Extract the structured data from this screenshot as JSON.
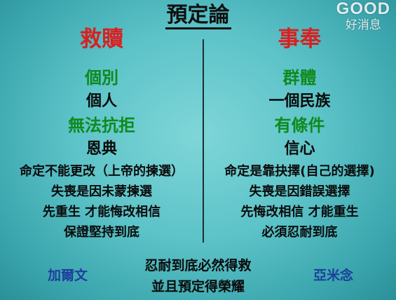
{
  "title": "預定論",
  "logo": {
    "en": "GOOD",
    "zh": "好消息"
  },
  "left": {
    "head": "救贖",
    "line1": "個別",
    "line2": "個人",
    "line3": "無法抗拒",
    "line4": "恩典",
    "line5": "命定不能更改（上帝的揀選）",
    "line6": "失喪是因未蒙揀選",
    "line7": "先重生 才能悔改相信",
    "line8": "保證堅持到底"
  },
  "right": {
    "head": "事奉",
    "line1": "群體",
    "line2": "一個民族",
    "line3": "有條件",
    "line4": "信心",
    "line5": "命定是靠抉擇(自己的選擇)",
    "line6": "失喪是因錯誤選擇",
    "line7": "先悔改相信 才能重生",
    "line8": "必須忍耐到底"
  },
  "bottom": {
    "line1": "忍耐到底必然得救",
    "line2": "並且預定得榮耀"
  },
  "books": {
    "left": "加爾文",
    "right": "亞米念"
  }
}
